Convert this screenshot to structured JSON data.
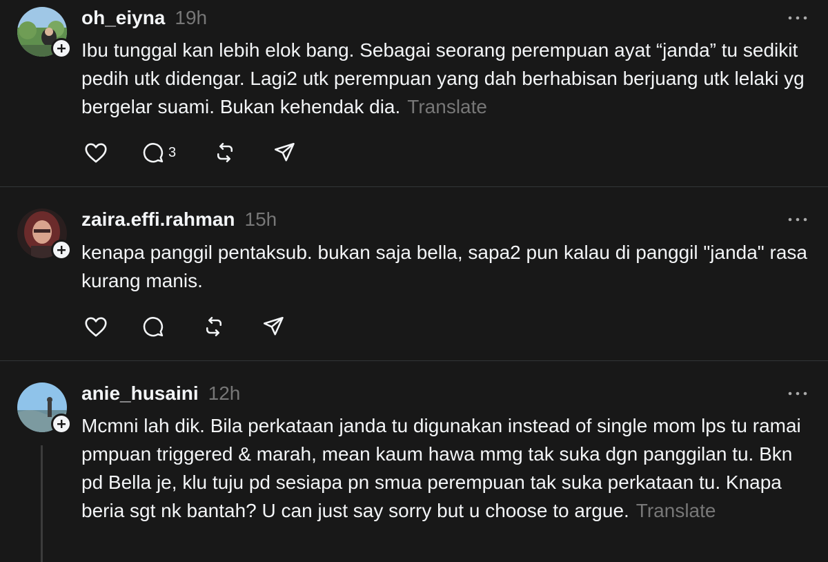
{
  "posts": [
    {
      "username": "oh_eiyna",
      "time": "19h",
      "text": "Ibu tunggal kan lebih elok bang. Sebagai seorang perempuan ayat “janda” tu sedikit pedih utk didengar. Lagi2 utk perempuan yang dah berhabisan berjuang utk lelaki yg bergelar suami. Bukan kehendak dia.",
      "translate": "Translate",
      "reply_count": "3"
    },
    {
      "username": "zaira.effi.rahman",
      "time": "15h",
      "text": "kenapa panggil pentaksub. bukan saja bella, sapa2 pun kalau di panggil \"janda\" rasa kurang manis.",
      "translate": "",
      "reply_count": ""
    },
    {
      "username": "anie_husaini",
      "time": "12h",
      "text": "Mcmni lah dik. Bila perkataan janda tu digunakan instead of single mom lps tu ramai pmpuan triggered & marah, mean kaum hawa mmg tak suka dgn panggilan tu. Bkn pd Bella je, klu tuju pd sesiapa pn smua perempuan tak suka perkataan tu. Knapa beria sgt nk bantah? U can just say sorry but u choose to argue.",
      "translate": "Translate",
      "reply_count": ""
    }
  ],
  "icons": {
    "like": "heart-icon",
    "reply": "comment-icon",
    "repost": "repost-icon",
    "share": "send-icon",
    "more": "more-icon",
    "follow": "plus-icon"
  },
  "colors": {
    "background": "#181818",
    "text": "#f3f5f7",
    "muted": "#777777",
    "divider": "#333638"
  }
}
